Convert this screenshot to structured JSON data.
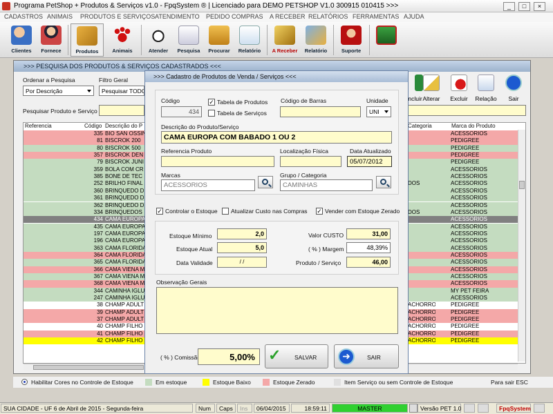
{
  "window": {
    "title": "Programa PetShop + Produtos & Serviços v1.0 - FpqSystem ® | Licenciado para  DEMO PETSHOP V1.0 300915 010415 >>>"
  },
  "menu": [
    "CADASTROS",
    "ANIMAIS",
    "PRODUTOS E SERVIÇOS",
    "ATENDIMENTO",
    "PEDIDO COMPRAS",
    "A RECEBER",
    "RELATÓRIOS",
    "FERRAMENTAS",
    "AJUDA"
  ],
  "toolbar": [
    "Clientes",
    "Fornece",
    "Produtos",
    "Animais",
    "Atender",
    "Pesquisa",
    "Procurar",
    "Relatório",
    "A Receber",
    "Relatório",
    "Suporte"
  ],
  "search_window": {
    "title": ">>> PESQUISA DOS PRODUTOS & SERVIÇOS CADASTRADOS <<<",
    "order_label": "Ordenar a Pesquisa",
    "order_value": "Por Descrição",
    "filter_label": "Filtro Geral",
    "filter_value": "Pesquisar TODO",
    "search_label": "Pesquisar Produto e Serviço",
    "buttons": [
      "Incluir",
      "Alterar",
      "Excluir",
      "Relação",
      "Sair"
    ],
    "columns": [
      "Referencia",
      "Código",
      "Descrição do P",
      "Categoria",
      "Marca do Produto"
    ],
    "rows": [
      {
        "code": "335",
        "desc": "BIO SAN OSSIN",
        "cat": "",
        "brand": "ACESSORIOS",
        "color": "#f4a8a8"
      },
      {
        "code": "81",
        "desc": "BISCROK 200",
        "cat": "",
        "brand": "PEDIGREE",
        "color": "#f4a8a8"
      },
      {
        "code": "80",
        "desc": "BISCROK 500",
        "cat": "",
        "brand": "PEDIGREE",
        "color": "#c4dcc0"
      },
      {
        "code": "357",
        "desc": "BISCROK DEN",
        "cat": "",
        "brand": "PEDIGREE",
        "color": "#f4a8a8"
      },
      {
        "code": "79",
        "desc": "BISCROK JUNI",
        "cat": "",
        "brand": "PEDIGREE",
        "color": "#c4dcc0"
      },
      {
        "code": "359",
        "desc": "BOLA COM CR",
        "cat": "",
        "brand": "ACESSORIOS",
        "color": "#c4dcc0"
      },
      {
        "code": "385",
        "desc": "BONE DE TEC",
        "cat": "",
        "brand": "ACESSORIOS",
        "color": "#c4dcc0"
      },
      {
        "code": "252",
        "desc": "BRILHO FINAL",
        "cat": "DOS",
        "brand": "ACESSORIOS",
        "color": "#c4dcc0"
      },
      {
        "code": "360",
        "desc": "BRINQUEDO D",
        "cat": "",
        "brand": "ACESSORIOS",
        "color": "#c4dcc0"
      },
      {
        "code": "361",
        "desc": "BRINQUEDO D",
        "cat": "",
        "brand": "ACESSORIOS",
        "color": "#c4dcc0"
      },
      {
        "code": "362",
        "desc": "BRINQUEDO D",
        "cat": "",
        "brand": "ACESSORIOS",
        "color": "#c4dcc0"
      },
      {
        "code": "334",
        "desc": "BRINQUEDOS",
        "cat": "DOS",
        "brand": "ACESSORIOS",
        "color": "#c4dcc0"
      },
      {
        "code": "434",
        "desc": "CAMA EUROPA",
        "cat": "",
        "brand": "ACESSORIOS",
        "color": "#808080"
      },
      {
        "code": "435",
        "desc": "CAMA EUROPA",
        "cat": "",
        "brand": "ACESSORIOS",
        "color": "#c4dcc0"
      },
      {
        "code": "197",
        "desc": "CAMA EUROPA",
        "cat": "",
        "brand": "ACESSORIOS",
        "color": "#c4dcc0"
      },
      {
        "code": "196",
        "desc": "CAMA EUROPA",
        "cat": "",
        "brand": "ACESSORIOS",
        "color": "#c4dcc0"
      },
      {
        "code": "363",
        "desc": "CAMA FLORIDA",
        "cat": "",
        "brand": "ACESSORIOS",
        "color": "#c4dcc0"
      },
      {
        "code": "364",
        "desc": "CAMA FLORIDA",
        "cat": "",
        "brand": "ACESSORIOS",
        "color": "#f4a8a8"
      },
      {
        "code": "365",
        "desc": "CAMA FLORIDA",
        "cat": "",
        "brand": "ACESSORIOS",
        "color": "#c4dcc0"
      },
      {
        "code": "366",
        "desc": "CAMA VIENA M",
        "cat": "",
        "brand": "ACESSORIOS",
        "color": "#f4a8a8"
      },
      {
        "code": "367",
        "desc": "CAMA VIENA M",
        "cat": "",
        "brand": "ACESSORIOS",
        "color": "#c4dcc0"
      },
      {
        "code": "368",
        "desc": "CAMA VIENA M",
        "cat": "",
        "brand": "ACESSORIOS",
        "color": "#f4a8a8"
      },
      {
        "code": "344",
        "desc": "CAMINHA IGLU",
        "cat": "",
        "brand": "MY PET FEIRA",
        "color": "#c4dcc0"
      },
      {
        "code": "247",
        "desc": "CAMINHA IGLU",
        "cat": "",
        "brand": "ACESSORIOS",
        "color": "#c4dcc0"
      },
      {
        "code": "38",
        "desc": "CHAMP ADULT",
        "cat": "ACHORRO",
        "brand": "PEDIGREE",
        "color": "#ffffff"
      },
      {
        "code": "39",
        "desc": "CHAMP ADULT",
        "cat": "ACHORRO",
        "brand": "PEDIGREE",
        "color": "#f4a8a8"
      },
      {
        "code": "37",
        "desc": "CHAMP ADULT",
        "cat": "ACHORRO",
        "brand": "PEDIGREE",
        "color": "#f4a8a8"
      },
      {
        "code": "40",
        "desc": "CHAMP FILHO",
        "cat": "ACHORRO",
        "brand": "PEDIGREE",
        "color": "#ffffff"
      },
      {
        "code": "41",
        "desc": "CHAMP FILHO",
        "cat": "ACHORRO",
        "brand": "PEDIGREE",
        "color": "#f4a8a8"
      },
      {
        "code": "42",
        "desc": "CHAMP FILHO",
        "cat": "ACHORRO",
        "brand": "PEDIGREE",
        "color": "#ffff00"
      }
    ]
  },
  "modal": {
    "title": ">>> Cadastro de Produtos de Venda / Serviços <<<",
    "codigo_label": "Código",
    "codigo": "434",
    "tabela_produtos": "Tabela de Produtos",
    "tabela_servicos": "Tabela de Serviços",
    "barcode_label": "Código de Barras",
    "unidade_label": "Unidade",
    "unidade": "UNI",
    "desc_label": "Descrição do Produto/Serviço",
    "desc": "CAMA EUROPA COM BABADO 1 OU 2",
    "ref_label": "Referencia Produto",
    "loc_label": "Localização Física",
    "date_label": "Data Atualizado",
    "date": "05/07/2012",
    "marcas_label": "Marcas",
    "marca": "ACESSORIOS",
    "grupo_label": "Grupo / Categoria",
    "grupo": "CAMINHAS",
    "controlar": "Controlar o Estoque",
    "atualizar": "Atualizar Custo nas Compras",
    "vender": "Vender com Estoque Zerado",
    "est_min_label": "Estoque Mínimo",
    "est_min": "2,0",
    "est_atual_label": "Estoque Atual",
    "est_atual": "5,0",
    "validade_label": "Data Validade",
    "validade": "/ /",
    "custo_label": "Valor CUSTO",
    "custo": "31,00",
    "margem_label": "( % ) Margem",
    "margem": "48,39%",
    "preco_label": "Produto / Serviço",
    "preco": "46,00",
    "obs_label": "Observação Gerais",
    "comissao_label": "( % ) Comissão",
    "comissao": "5,00%",
    "salvar": "SALVAR",
    "sair": "SAIR"
  },
  "legend": {
    "habilitar": "Habilitar Cores no Controle de Estoque",
    "items": [
      {
        "label": "Em estoque",
        "color": "#c4dcc0"
      },
      {
        "label": "Estoque Baixo",
        "color": "#ffff00"
      },
      {
        "label": "Estoque Zerado",
        "color": "#f4a8a8"
      },
      {
        "label": "Item Serviço ou sem Controle de Estoque",
        "color": "#e0e0e0"
      }
    ],
    "exit_hint": "Para sair ESC"
  },
  "status": {
    "city": "SUA CIDADE - UF  6 de Abril de 2015 - Segunda-feira",
    "num": "Num",
    "caps": "Caps",
    "ins": "Ins",
    "date": "06/04/2015",
    "time": "18:59:11",
    "master": "MASTER",
    "version": "Versão PET 1.0",
    "brand": "FpqSystem"
  }
}
